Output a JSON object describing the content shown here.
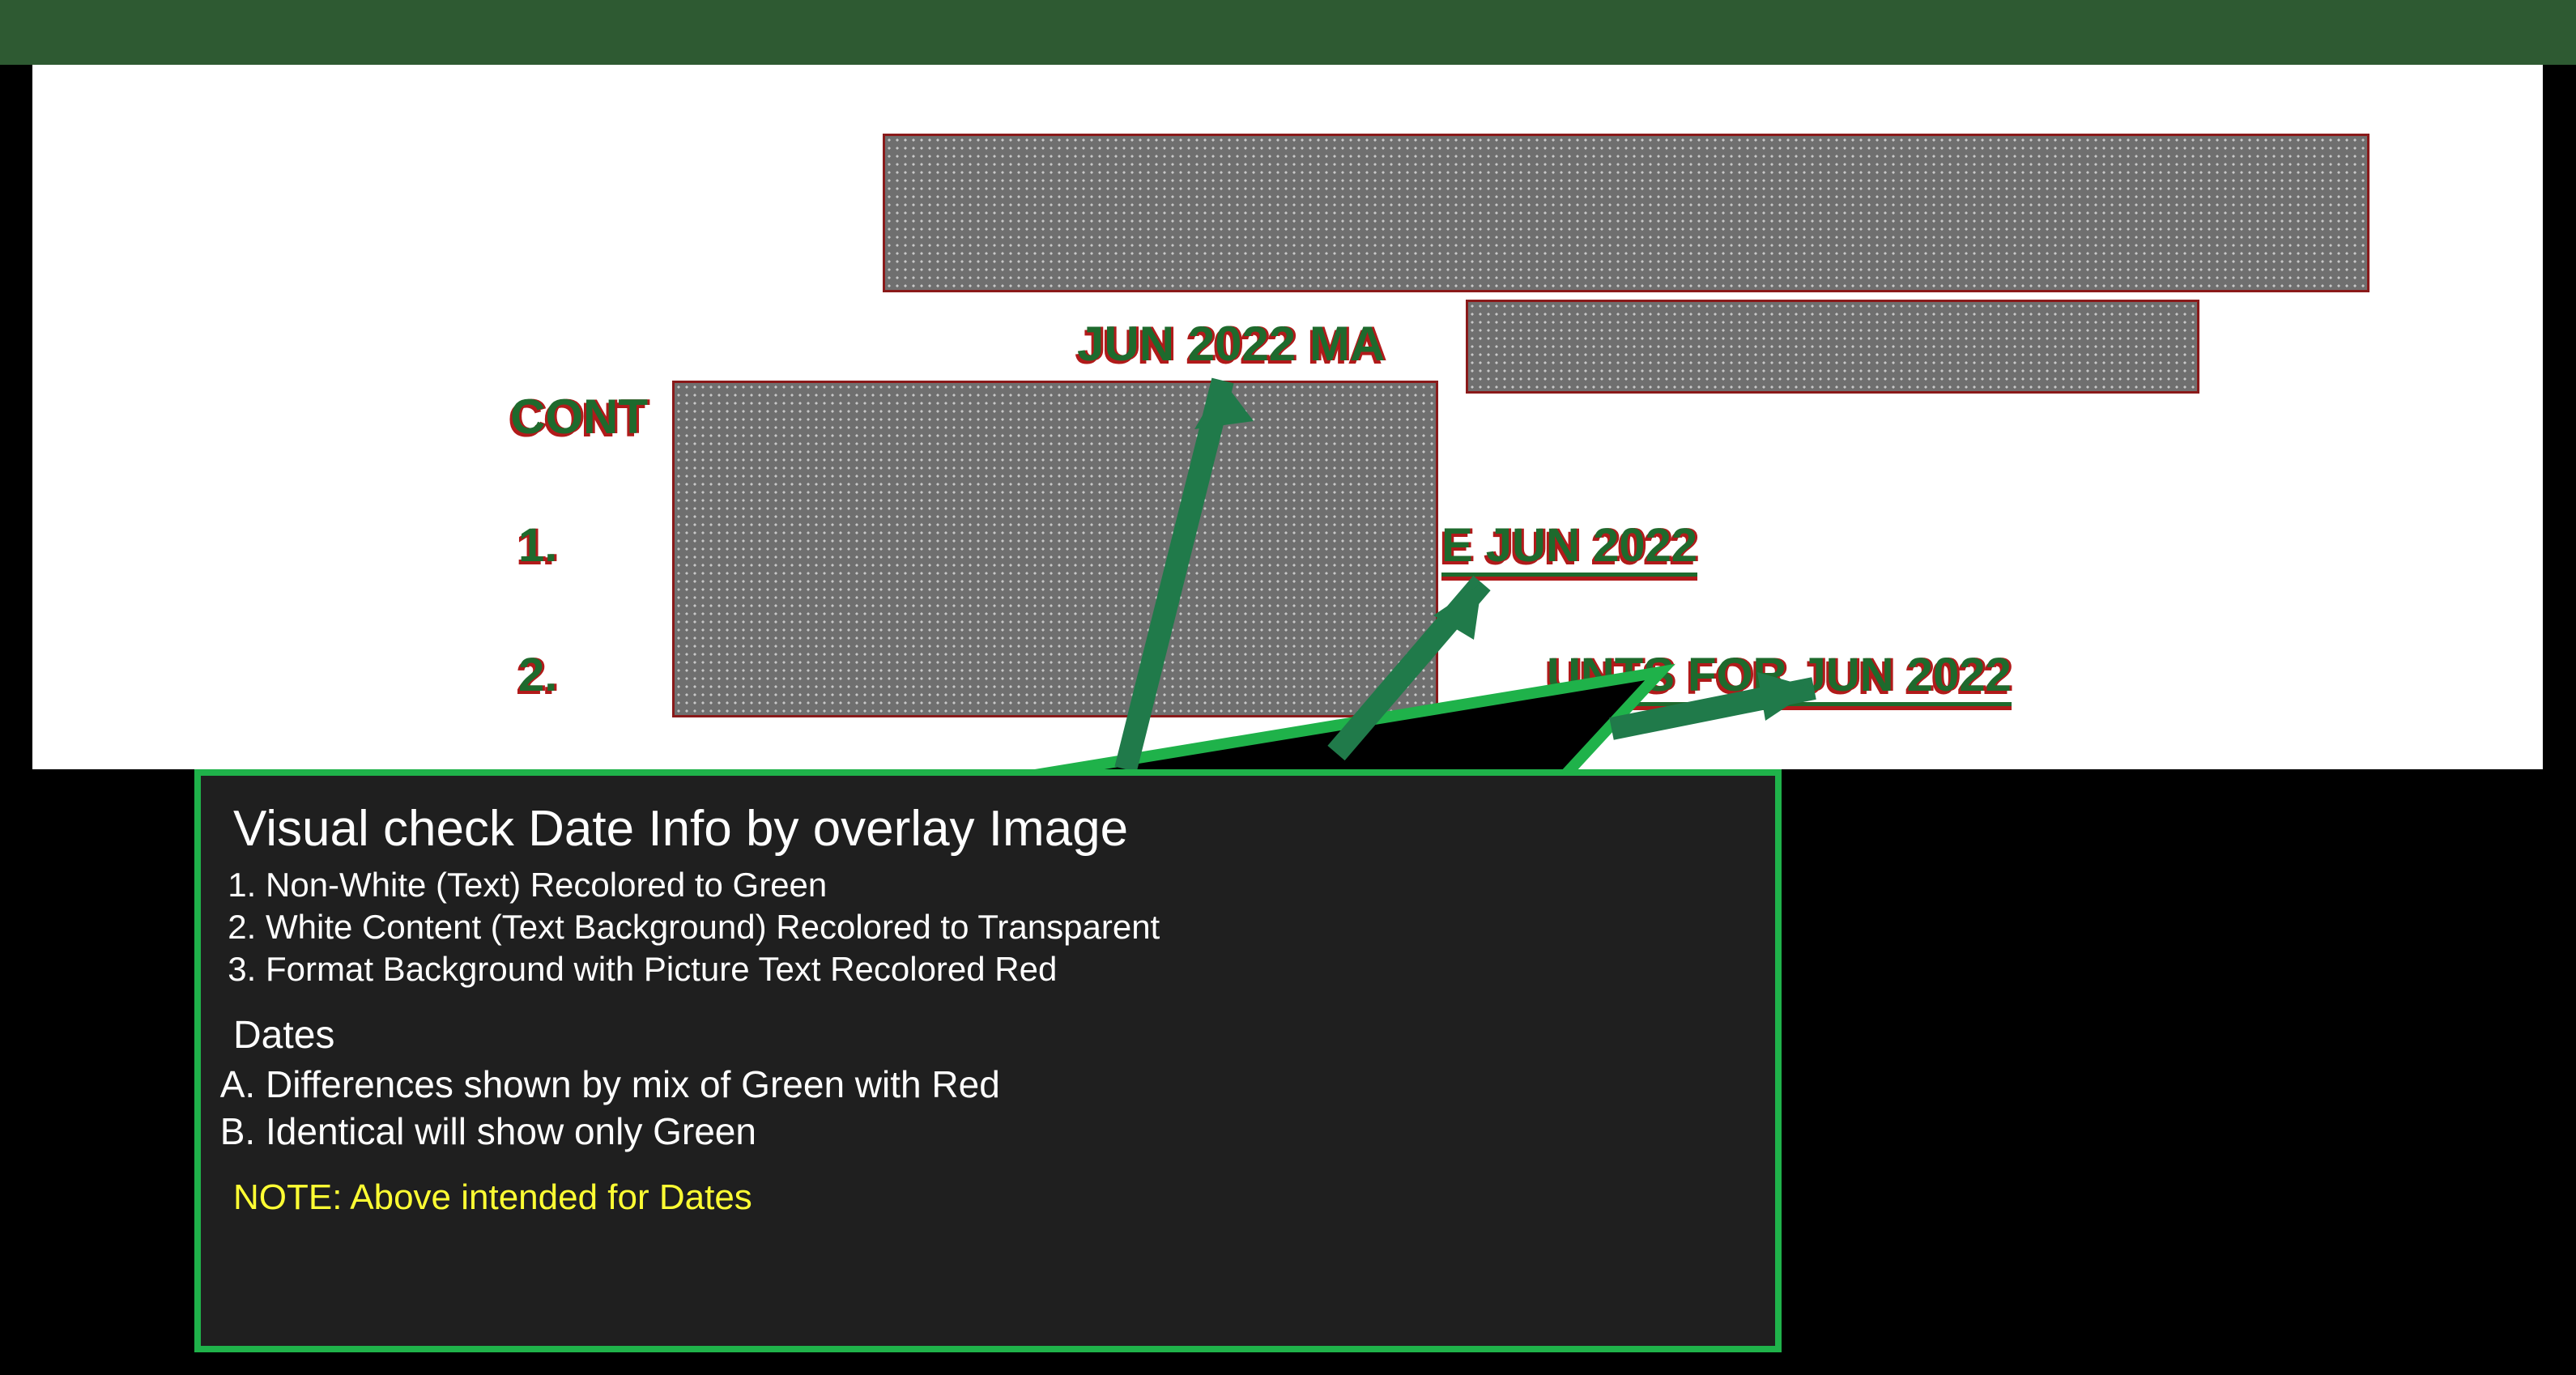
{
  "doc": {
    "header_fragment": "JUN 2022 MA",
    "cont_label": "CONT",
    "line1_num": "1.",
    "line1_tail": "E JUN 2022",
    "line2_num": "2.",
    "line2_tail": "UNTS FOR JUN 2022"
  },
  "callout": {
    "title": "Visual check Date Info by overlay Image",
    "steps": [
      "Non-White (Text) Recolored to Green",
      "White Content (Text Background) Recolored to Transparent",
      "Format Background with Picture Text Recolored Red"
    ],
    "dates_heading": "Dates",
    "dates_items": [
      "Differences shown by mix of Green with Red",
      "Identical will show only Green"
    ],
    "note": "NOTE: Above intended for Dates"
  },
  "colors": {
    "brand_green": "#2E5A32",
    "overlay_green": "#1e6a2d",
    "overlay_red": "#b11a1a",
    "callout_border": "#1fb24a",
    "note_yellow": "#ffff33"
  }
}
